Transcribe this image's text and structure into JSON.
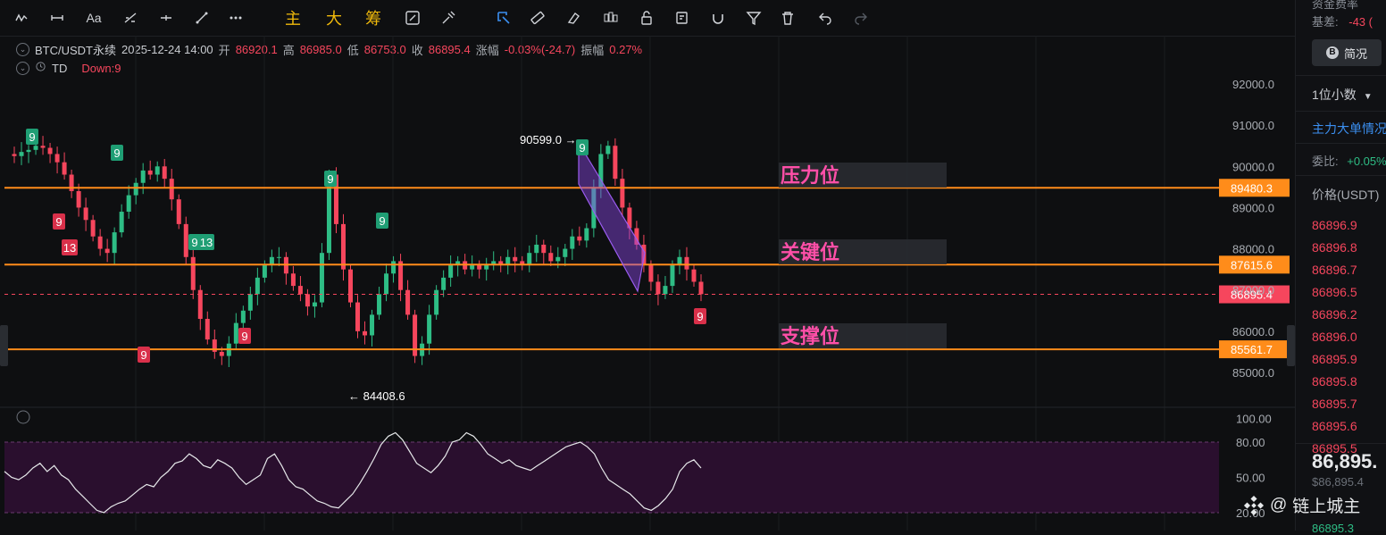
{
  "toolbar": {
    "tools": [
      "trend-line-icon",
      "horizontal-line-icon",
      "text-icon",
      "fib-icon",
      "ray-icon",
      "measure-icon",
      "more-icon"
    ],
    "cn_buttons": [
      "主",
      "大",
      "筹"
    ],
    "right_tools": [
      "snapshot-icon",
      "brush-icon",
      "cursor-icon",
      "ruler-icon",
      "eraser-icon",
      "candles-icon",
      "lock-icon",
      "notes-icon",
      "magnet-icon",
      "filter-icon",
      "trash-icon",
      "undo-icon",
      "redo-icon"
    ]
  },
  "info": {
    "symbol": "BTC/USDT永续",
    "datetime": "2025-12-24 14:00",
    "open_label": "开",
    "open": "86920.1",
    "high_label": "高",
    "high": "86985.0",
    "low_label": "低",
    "low": "86753.0",
    "close_label": "收",
    "close": "86895.4",
    "change_label": "涨幅",
    "change": "-0.03%(-24.7)",
    "amp_label": "振幅",
    "amp": "0.27%",
    "indicator": "TD",
    "indicator_value": "Down:9"
  },
  "chart_data": {
    "type": "candlestick",
    "ylim": [
      84000,
      92500
    ],
    "y_ticks": [
      "92000.0",
      "91000.0",
      "90000.0",
      "89000.0",
      "88000.0",
      "87000.0",
      "86000.0",
      "85000.0"
    ],
    "y_tick_values": [
      92000,
      91000,
      90000,
      89000,
      88000,
      87000,
      86000,
      85000
    ],
    "close_series": [
      90300,
      90250,
      90350,
      90400,
      90500,
      90450,
      90300,
      90100,
      89800,
      89400,
      89000,
      88700,
      88300,
      88000,
      87900,
      88400,
      88900,
      89300,
      89600,
      89900,
      89800,
      90000,
      89700,
      89200,
      88600,
      87800,
      87000,
      86300,
      85800,
      85500,
      85400,
      85700,
      86200,
      86500,
      86900,
      87300,
      87600,
      87800,
      87800,
      87400,
      87100,
      86900,
      86600,
      86700,
      87900,
      89800,
      88600,
      87500,
      86700,
      86000,
      85900,
      86400,
      86900,
      87400,
      87700,
      87000,
      86400,
      85400,
      85700,
      86400,
      87000,
      87300,
      87600,
      87700,
      87500,
      87600,
      87500,
      87600,
      87700,
      87600,
      87800,
      87700,
      87600,
      87900,
      88100,
      87900,
      87700,
      87800,
      88000,
      88300,
      88200,
      88500,
      89500,
      90300,
      90500,
      89700,
      89000,
      88500,
      88100,
      87600,
      87200,
      86900,
      87100,
      87600,
      87800,
      87500,
      87200,
      86900
    ],
    "horizontal_levels": [
      {
        "name": "压力位",
        "value": "89480.3",
        "color": "#ff8c1a"
      },
      {
        "name": "关键位",
        "value": "87615.6",
        "color": "#ff8c1a"
      },
      {
        "name": "支撑位",
        "value": "85561.7",
        "color": "#ff8c1a"
      }
    ],
    "current_price": "86895.4",
    "high_marker": "90599.0",
    "low_marker": "84408.6",
    "td_labels": [
      {
        "text": "9",
        "type": "up"
      },
      {
        "text": "9",
        "type": "up"
      },
      {
        "text": "9",
        "type": "down"
      },
      {
        "text": "13",
        "type": "down"
      },
      {
        "text": "9",
        "type": "up"
      },
      {
        "text": "13",
        "type": "up"
      },
      {
        "text": "9",
        "type": "down"
      },
      {
        "text": "9",
        "type": "down"
      },
      {
        "text": "9",
        "type": "up"
      },
      {
        "text": "9",
        "type": "up"
      },
      {
        "text": "9",
        "type": "up"
      },
      {
        "text": "9",
        "type": "down"
      }
    ]
  },
  "rsi": {
    "y_ticks": [
      "100.00",
      "80.00",
      "50.00",
      "20.00"
    ],
    "y_tick_values": [
      100,
      80,
      50,
      20
    ],
    "values": [
      55,
      50,
      48,
      52,
      58,
      62,
      55,
      60,
      52,
      48,
      40,
      34,
      28,
      22,
      20,
      25,
      28,
      30,
      35,
      40,
      44,
      42,
      50,
      55,
      62,
      64,
      70,
      66,
      60,
      58,
      65,
      62,
      58,
      50,
      44,
      48,
      52,
      66,
      70,
      60,
      48,
      42,
      40,
      35,
      30,
      28,
      25,
      24,
      30,
      36,
      45,
      55,
      66,
      78,
      85,
      88,
      82,
      72,
      62,
      58,
      54,
      60,
      68,
      80,
      82,
      88,
      85,
      78,
      70,
      66,
      62,
      65,
      60,
      58,
      56,
      60,
      64,
      68,
      72,
      76,
      78,
      80,
      76,
      70,
      58,
      48,
      44,
      40,
      36,
      30,
      24,
      22,
      26,
      32,
      40,
      55,
      62,
      65,
      58
    ]
  },
  "sidebar": {
    "funding_label": "资金费率",
    "basis_label": "基差:",
    "basis_value": "-43 (",
    "lang_button": "简况",
    "decimals": "1位小数",
    "big_orders": "主力大单情况",
    "ratio_label": "委比:",
    "ratio_value": "+0.05%",
    "price_header": "价格(USDT)",
    "prices": [
      "86896.9",
      "86896.8",
      "86896.7",
      "86896.5",
      "86896.2",
      "86896.0",
      "86895.9",
      "86895.8",
      "86895.7",
      "86895.6",
      "86895.5"
    ],
    "last_price": "86,895.",
    "last_price_usd": "$86,895.4",
    "bottom_price": "86895.3"
  },
  "watermark": "链上城主"
}
